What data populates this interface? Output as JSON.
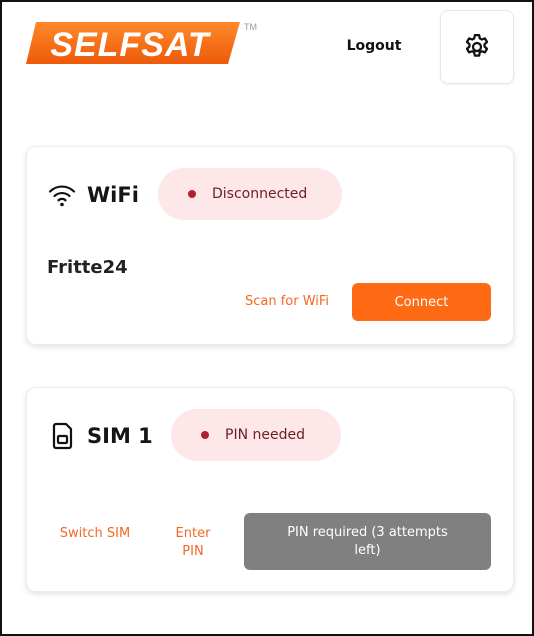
{
  "header": {
    "brand": "SELFSAT",
    "trademark": "TM",
    "logout_label": "Logout",
    "settings_icon": "gear-icon"
  },
  "wifi_card": {
    "icon": "wifi-icon",
    "title": "WiFi",
    "status": "Disconnected",
    "network_name": "Fritte24",
    "scan_label": "Scan for WiFi",
    "connect_label": "Connect"
  },
  "sim_card": {
    "icon": "sim-card-icon",
    "title": "SIM 1",
    "status": "PIN needed",
    "switch_label": "Switch SIM",
    "enter_pin_label": "Enter PIN",
    "pin_required_label": "PIN required (3 attempts left)"
  },
  "colors": {
    "brand_orange": "#ff6a14",
    "status_bg": "#fde7e8",
    "status_dot": "#b3202b",
    "disabled_button": "#808080"
  }
}
